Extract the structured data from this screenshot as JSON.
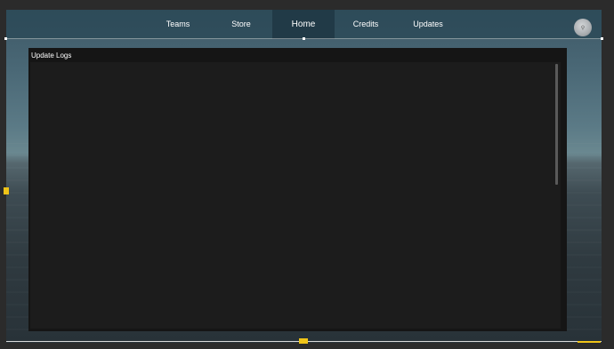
{
  "navbar": {
    "tabs": [
      {
        "label": "Teams",
        "active": false
      },
      {
        "label": "Store",
        "active": false
      },
      {
        "label": "Home",
        "active": true
      },
      {
        "label": "Credits",
        "active": false
      },
      {
        "label": "Updates",
        "active": false
      }
    ]
  },
  "panel": {
    "title": "Update Logs",
    "content": ""
  },
  "colors": {
    "navbar_bg": "#2d4a58",
    "panel_bg": "#151515",
    "log_area_bg": "#1c1c1c",
    "selection_handle": "#f0c418"
  },
  "icons": {
    "avatar": "player-avatar-icon"
  }
}
